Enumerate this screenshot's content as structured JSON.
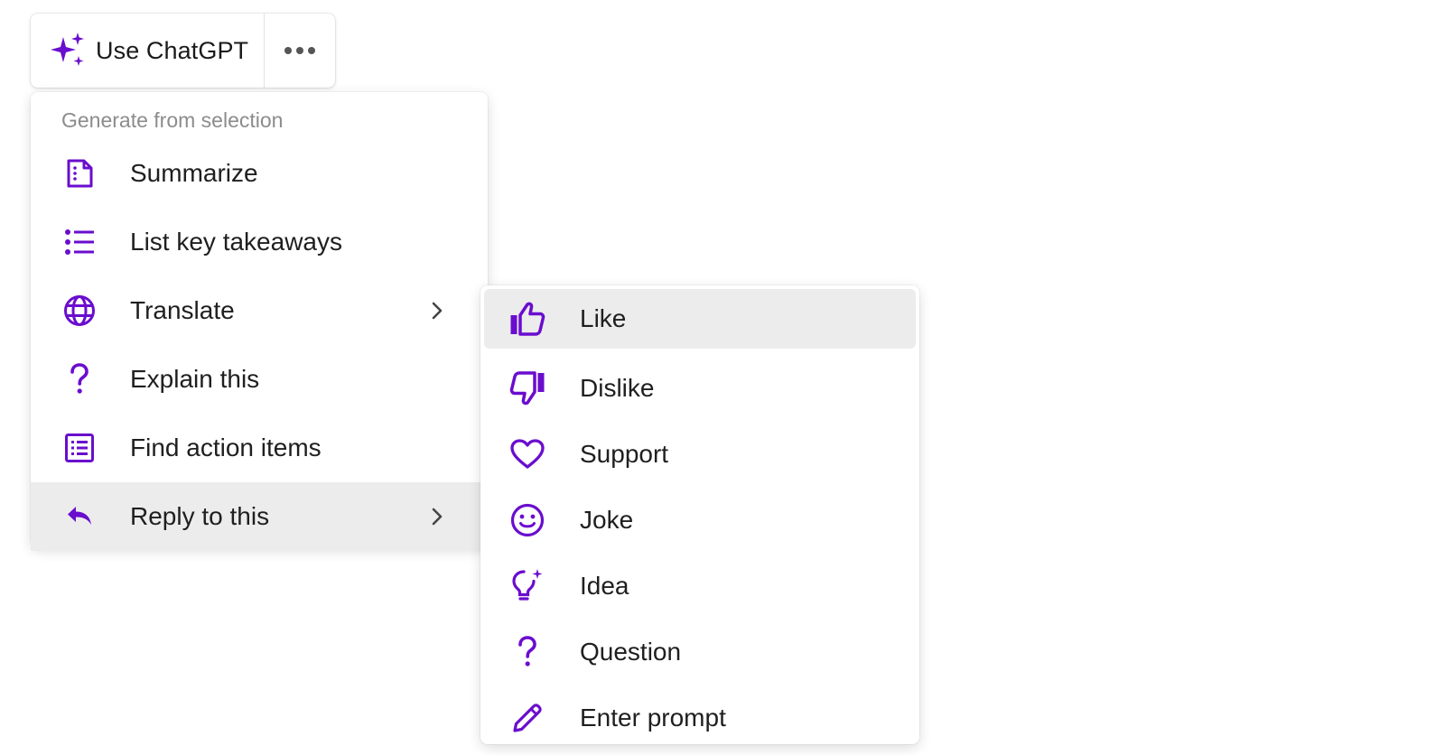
{
  "colors": {
    "accent": "#6a0dce",
    "hover_bg": "#ececec",
    "text": "#1f1f1f",
    "muted": "#8c8c8c"
  },
  "toolbar": {
    "label": "Use ChatGPT",
    "icon": "sparkles-icon",
    "more_icon": "more-horizontal-icon"
  },
  "menu": {
    "section_title": "Generate from selection",
    "items": [
      {
        "label": "Summarize",
        "icon": "document-icon"
      },
      {
        "label": "List key takeaways",
        "icon": "list-icon"
      },
      {
        "label": "Translate",
        "icon": "globe-icon",
        "submenu": true
      },
      {
        "label": "Explain this",
        "icon": "question-icon"
      },
      {
        "label": "Find action items",
        "icon": "checklist-icon"
      },
      {
        "label": "Reply to this",
        "icon": "reply-icon",
        "submenu": true,
        "active": true
      }
    ]
  },
  "submenu": {
    "items": [
      {
        "label": "Like",
        "icon": "thumbs-up-icon",
        "active": true
      },
      {
        "label": "Dislike",
        "icon": "thumbs-down-icon"
      },
      {
        "label": "Support",
        "icon": "heart-icon"
      },
      {
        "label": "Joke",
        "icon": "smile-icon"
      },
      {
        "label": "Idea",
        "icon": "lightbulb-icon"
      },
      {
        "label": "Question",
        "icon": "question-icon"
      },
      {
        "label": "Enter prompt",
        "icon": "pencil-icon"
      }
    ]
  }
}
